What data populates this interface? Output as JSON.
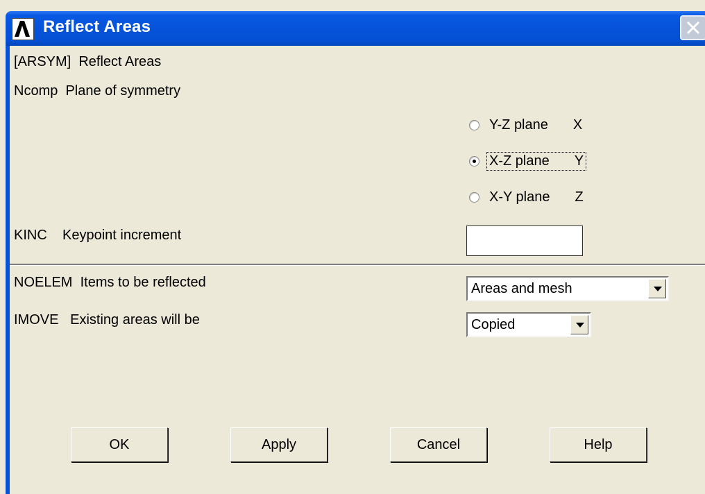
{
  "window": {
    "title": "Reflect Areas"
  },
  "dialog": {
    "header": "[ARSYM]  Reflect Areas",
    "ncomp_label": "Ncomp  Plane of symmetry",
    "radios": [
      {
        "label": "Y-Z plane",
        "axis": "X",
        "checked": false
      },
      {
        "label": "X-Z plane",
        "axis": "Y",
        "checked": true
      },
      {
        "label": "X-Y plane",
        "axis": "Z",
        "checked": false
      }
    ],
    "kinc_label": "KINC    Keypoint increment",
    "kinc_value": "",
    "noelem_label": "NOELEM  Items to be reflected",
    "noelem_value": "Areas and mesh",
    "imove_label": "IMOVE   Existing areas will be",
    "imove_value": "Copied",
    "buttons": {
      "ok": "OK",
      "apply": "Apply",
      "cancel": "Cancel",
      "help": "Help"
    }
  }
}
